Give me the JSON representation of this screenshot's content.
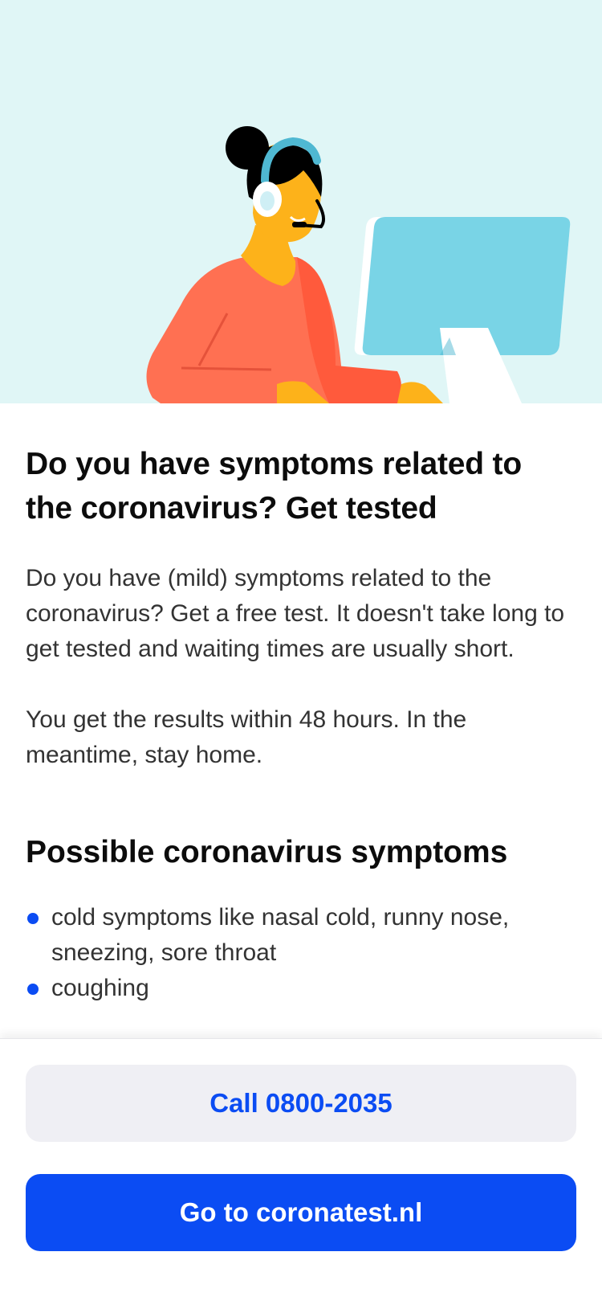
{
  "content": {
    "title": "Do you have symptoms related to the coronavirus? Get tested",
    "paragraph1": "Do you have (mild) symptoms related to the coronavirus? Get a free test. It doesn't take long to get tested and waiting times are usually short.",
    "paragraph2": "You get the results within 48 hours. In the meantime, stay home.",
    "symptoms_heading": "Possible coronavirus symptoms",
    "symptoms": [
      "cold symptoms like nasal cold, runny nose, sneezing, sore throat",
      "coughing"
    ]
  },
  "actions": {
    "call_label": "Call 0800-2035",
    "website_label": "Go to coronatest.nl"
  },
  "colors": {
    "accent": "#0b4cf3",
    "hero_background": "#e0f6f6",
    "secondary_button": "#efeff4"
  },
  "illustration": {
    "name": "call-center-agent-illustration"
  }
}
